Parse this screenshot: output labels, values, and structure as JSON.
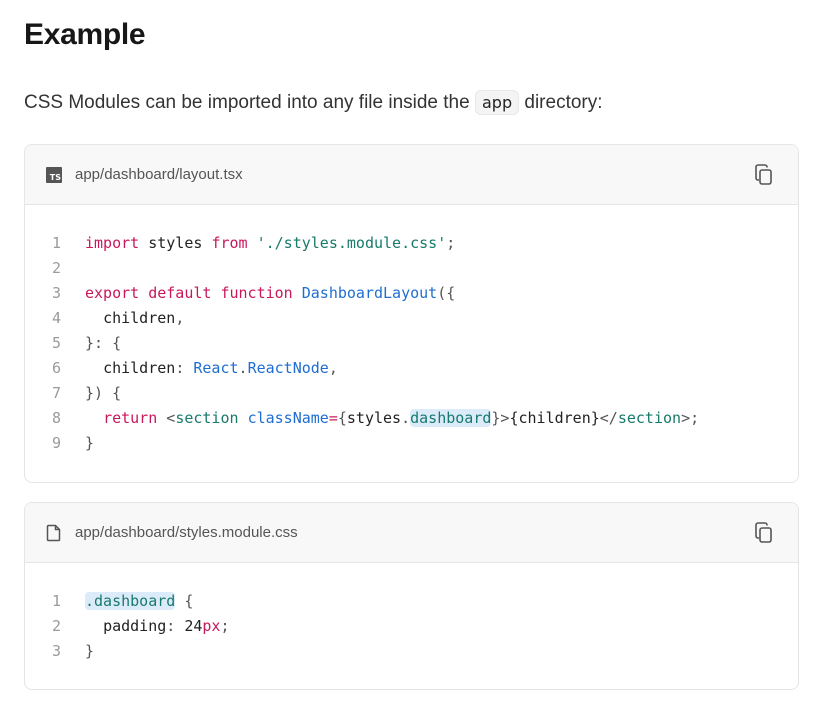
{
  "heading": "Example",
  "intro": {
    "before": "CSS Modules can be imported into any file inside the ",
    "code": "app",
    "after": " directory:"
  },
  "blocks": [
    {
      "filename": "app/dashboard/layout.tsx",
      "file_icon": "typescript-file-icon",
      "file_icon_label": "TS",
      "copy_icon": "copy-icon",
      "line_numbers": [
        "1",
        "2",
        "3",
        "4",
        "5",
        "6",
        "7",
        "8",
        "9"
      ]
    },
    {
      "filename": "app/dashboard/styles.module.css",
      "file_icon": "file-icon",
      "copy_icon": "copy-icon",
      "line_numbers": [
        "1",
        "2",
        "3"
      ]
    }
  ],
  "tokens": {
    "import": "import",
    "styles": " styles ",
    "from": "from",
    "path": "'./styles.module.css'",
    "semi": ";",
    "export": "export",
    "default": "default",
    "function": "function",
    "fname": "DashboardLayout",
    "open": "({",
    "children": "children",
    "comma": ",",
    "close_colon": "}: {",
    "colon": ":",
    "react": "React",
    "dot": ".",
    "reactnode": "ReactNode",
    "close_paren": "}) {",
    "return": "return",
    "lt": "<",
    "section": "section",
    "classname": "className",
    "eq": "=",
    "lbrace": "{",
    "styles_id": "styles",
    "dashboard": "dashboard",
    "rbrace_gt": "}>",
    "children_expr": "{children}",
    "close_tag_open": "</",
    "gt_semi": ">;",
    "rbrace": "}",
    "css_sel": ".dashboard",
    "css_open": " {",
    "padding": "padding",
    "num": "24",
    "unit": "px"
  },
  "colors": {
    "keyword": "#c8185c",
    "string": "#187a6a",
    "function": "#1f6ed0",
    "highlight": "#dcebfa"
  }
}
